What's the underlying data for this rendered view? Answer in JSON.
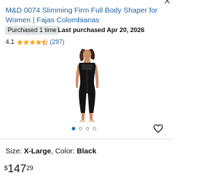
{
  "product": {
    "title": "M&D 0074 Slimming Firm Full Body Shaper for Women | Fajas Colombianas",
    "purchase_badge": "Purchased 1 time",
    "last_purchased": "Last purchased Apr 20, 2026",
    "rating_value": "4.1",
    "rating_stars": 4.1,
    "rating_count": "(297)",
    "image_icon": "body-shaper-product-image"
  },
  "carousel": {
    "total": 4,
    "active_index": 0
  },
  "variant": {
    "size_label": "Size: ",
    "size_value": "X-Large",
    "separator": ", ",
    "color_label": "Color: ",
    "color_value": "Black"
  },
  "price": {
    "symbol": "$",
    "whole": "147",
    "fraction": "29"
  },
  "icons": {
    "close": "close-icon",
    "heart": "heart-icon",
    "star": "star-icon"
  },
  "colors": {
    "link": "#2162a1",
    "star": "#ffa41c",
    "dot_active": "#1a6fb0"
  }
}
